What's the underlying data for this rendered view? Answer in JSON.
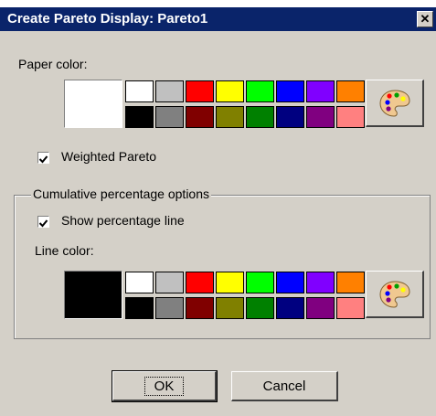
{
  "dialog": {
    "title": "Create Pareto Display: Pareto1",
    "close_glyph": "✕"
  },
  "paper": {
    "label": "Paper color:",
    "selected_color": "#ffffff"
  },
  "weighted": {
    "label": "Weighted Pareto",
    "checked": true
  },
  "cumulative": {
    "group_label": "Cumulative percentage options",
    "show_line_label": "Show percentage line",
    "show_line_checked": true,
    "line_color_label": "Line color:",
    "selected_color": "#000000"
  },
  "palette": {
    "row1": [
      "#ffffff",
      "#c0c0c0",
      "#ff0000",
      "#ffff00",
      "#00ff00",
      "#0000ff",
      "#8000ff",
      "#ff8000"
    ],
    "row2": [
      "#000000",
      "#808080",
      "#800000",
      "#808000",
      "#008000",
      "#000080",
      "#800080",
      "#ff8080"
    ],
    "icon": "palette-icon"
  },
  "buttons": {
    "ok": "OK",
    "cancel": "Cancel"
  }
}
